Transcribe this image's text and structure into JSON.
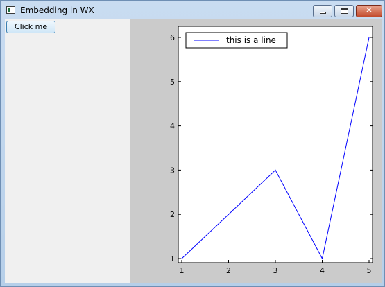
{
  "window": {
    "title": "Embedding in WX",
    "close_glyph": "✕"
  },
  "panel": {
    "button_label": "Click me"
  },
  "chart_data": {
    "type": "line",
    "x": [
      1,
      2,
      3,
      4,
      5
    ],
    "series": [
      {
        "name": "this is a line",
        "values": [
          1,
          2,
          3,
          1,
          6
        ],
        "color": "#0000ff"
      }
    ],
    "xticks": [
      "1",
      "2",
      "3",
      "4",
      "5"
    ],
    "yticks": [
      "1",
      "2",
      "3",
      "4",
      "5",
      "6"
    ],
    "xlim": [
      1,
      5
    ],
    "ylim": [
      1,
      6
    ],
    "grid": false,
    "legend_position": "top-left"
  }
}
